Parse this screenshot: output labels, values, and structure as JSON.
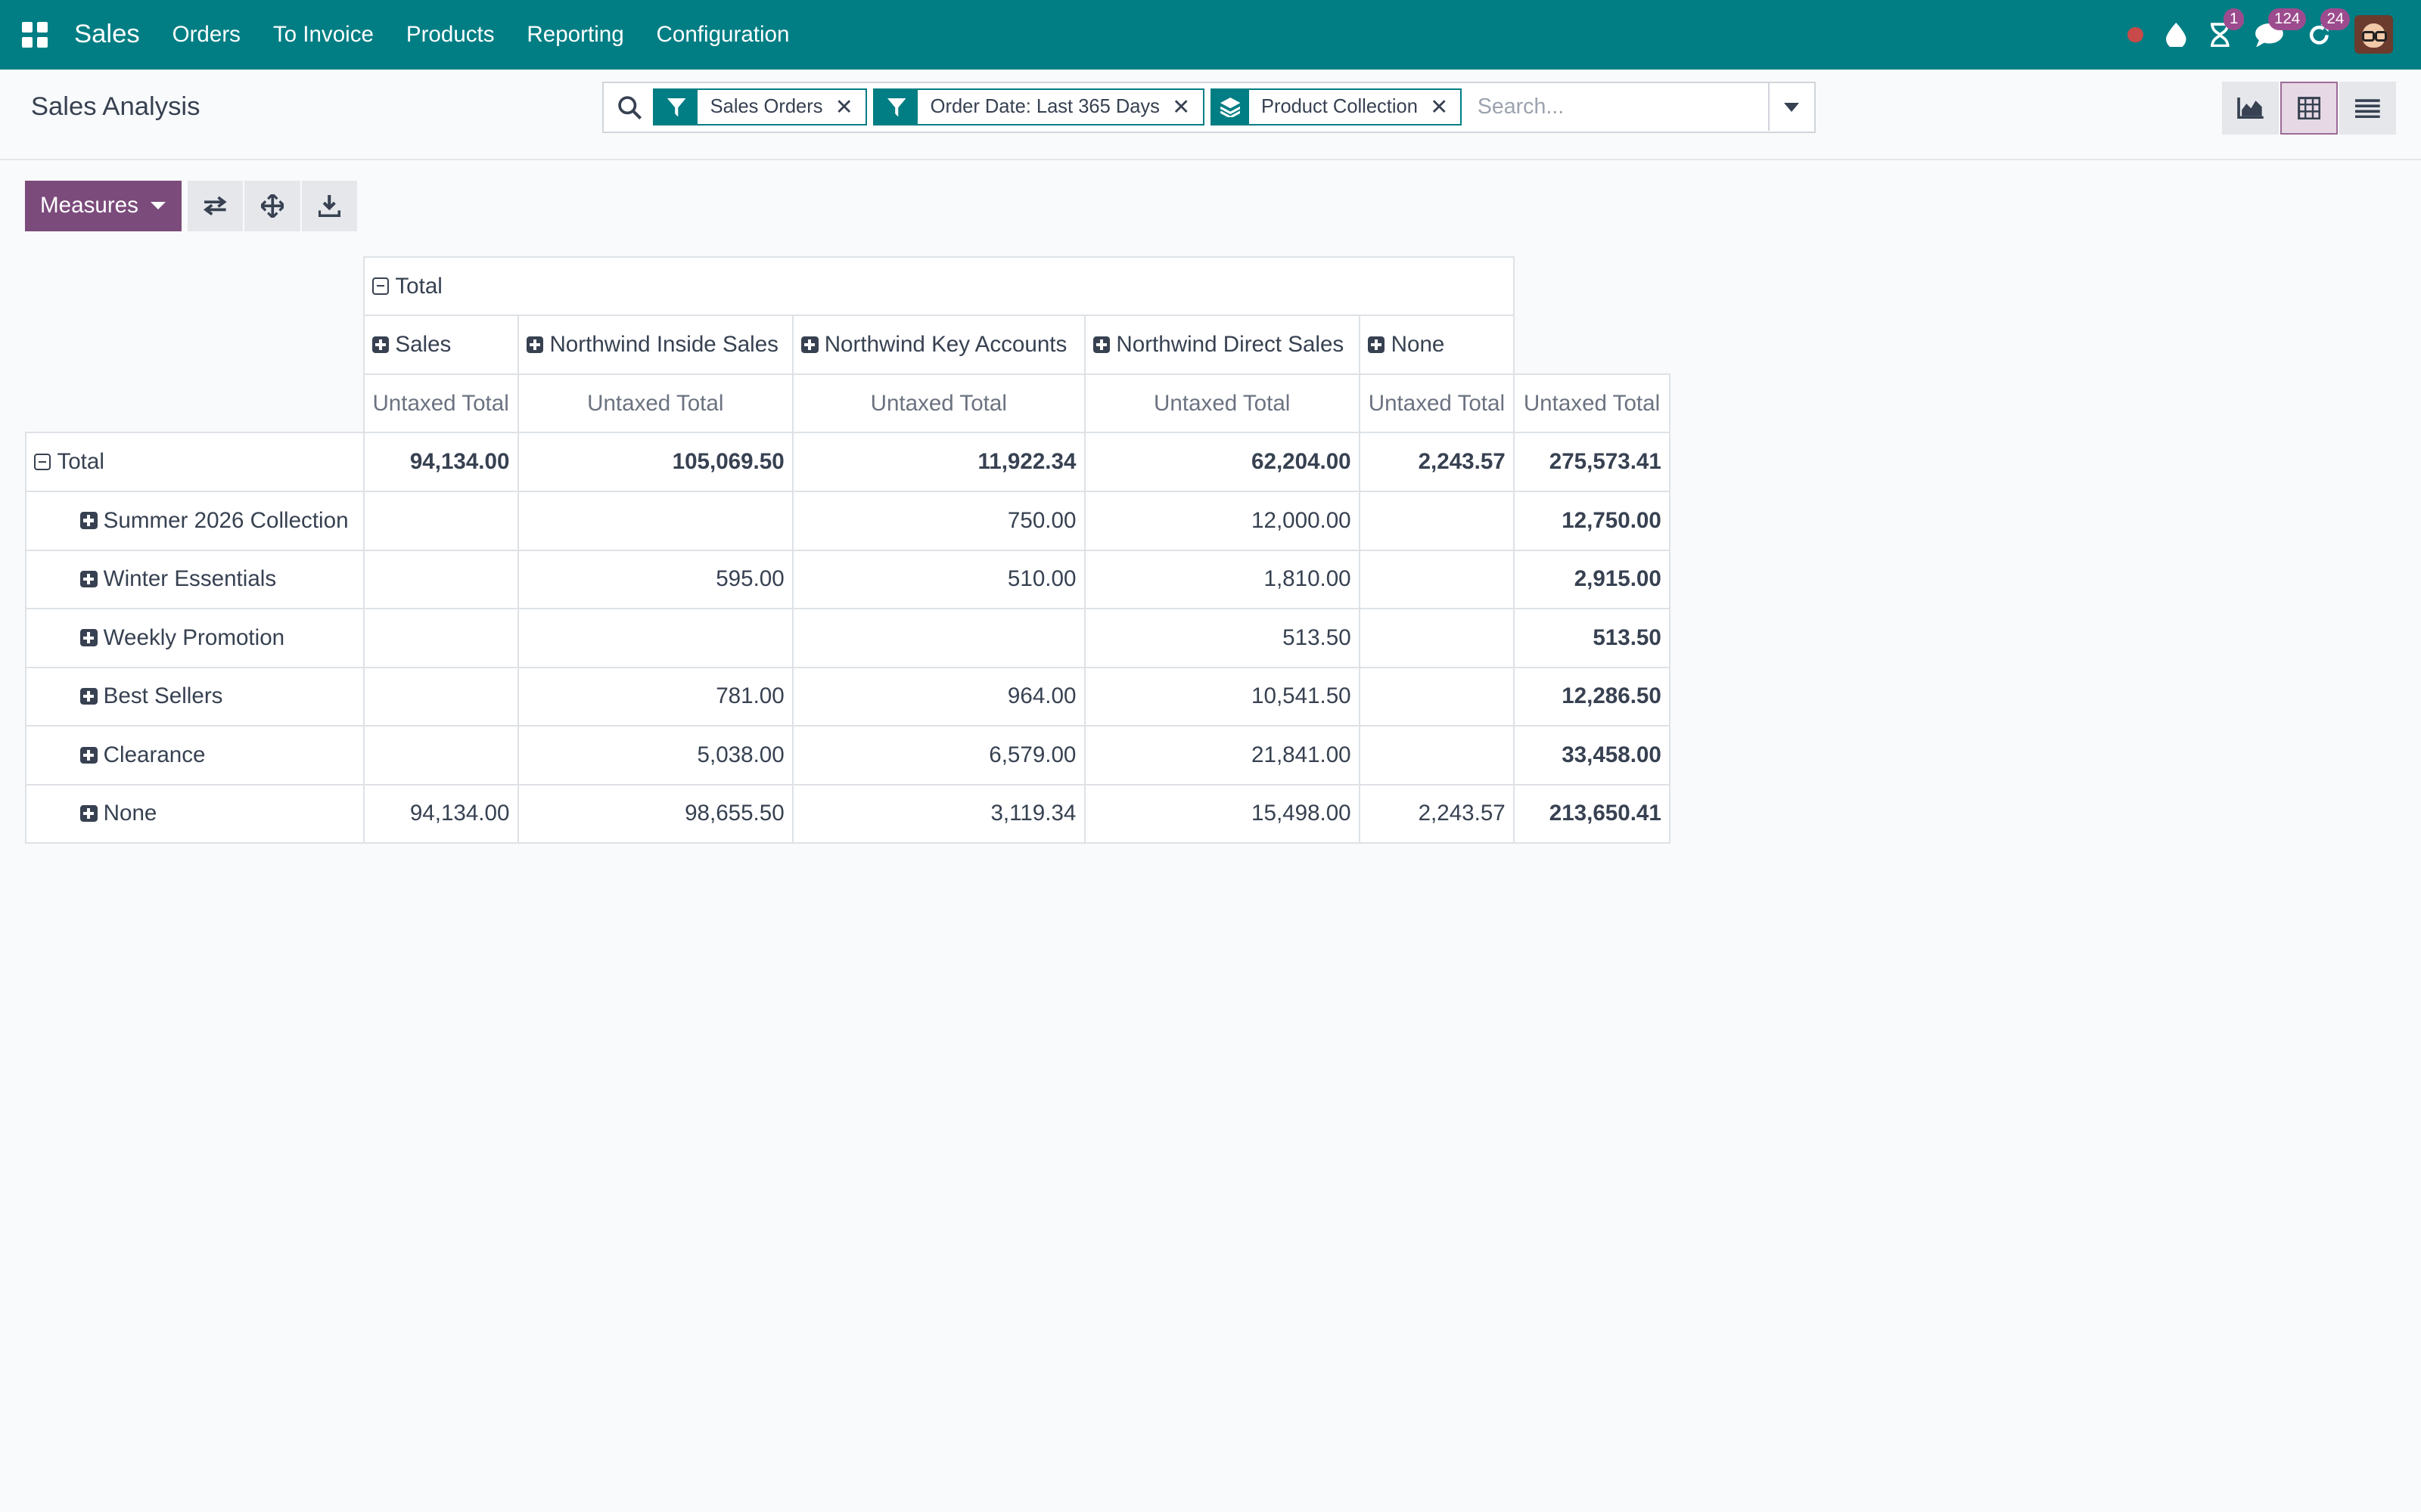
{
  "navbar": {
    "app_name": "Sales",
    "menu": [
      "Orders",
      "To Invoice",
      "Products",
      "Reporting",
      "Configuration"
    ],
    "badges": {
      "activities": "1",
      "messages": "124",
      "updates": "24"
    },
    "brand_color": "#017e84"
  },
  "control_panel": {
    "title": "Sales Analysis",
    "facets": [
      {
        "icon": "filter-icon",
        "label": "Sales Orders"
      },
      {
        "icon": "filter-icon",
        "label": "Order Date: Last 365 Days"
      },
      {
        "icon": "layers-icon",
        "label": "Product Collection"
      }
    ],
    "search_placeholder": "Search...",
    "views": [
      "graph-view",
      "pivot-view",
      "list-view"
    ],
    "active_view": "pivot-view"
  },
  "toolbar": {
    "measures_label": "Measures",
    "accent_color": "#7b4b7b"
  },
  "pivot": {
    "col_total_label": "Total",
    "col_groups": [
      "Sales",
      "Northwind Inside Sales",
      "Northwind Key Accounts",
      "Northwind Direct Sales",
      "None"
    ],
    "measure_label": "Untaxed Total",
    "rows": [
      {
        "label": "Total",
        "values": [
          "94,134.00",
          "105,069.50",
          "11,922.34",
          "62,204.00",
          "2,243.57",
          "275,573.41"
        ]
      },
      {
        "label": "Summer 2026 Collection",
        "values": [
          "",
          "",
          "750.00",
          "12,000.00",
          "",
          "12,750.00"
        ]
      },
      {
        "label": "Winter Essentials",
        "values": [
          "",
          "595.00",
          "510.00",
          "1,810.00",
          "",
          "2,915.00"
        ]
      },
      {
        "label": "Weekly Promotion",
        "values": [
          "",
          "",
          "",
          "513.50",
          "",
          "513.50"
        ]
      },
      {
        "label": "Best Sellers",
        "values": [
          "",
          "781.00",
          "964.00",
          "10,541.50",
          "",
          "12,286.50"
        ]
      },
      {
        "label": "Clearance",
        "values": [
          "",
          "5,038.00",
          "6,579.00",
          "21,841.00",
          "",
          "33,458.00"
        ]
      },
      {
        "label": "None",
        "values": [
          "94,134.00",
          "98,655.50",
          "3,119.34",
          "15,498.00",
          "2,243.57",
          "213,650.41"
        ]
      }
    ]
  }
}
